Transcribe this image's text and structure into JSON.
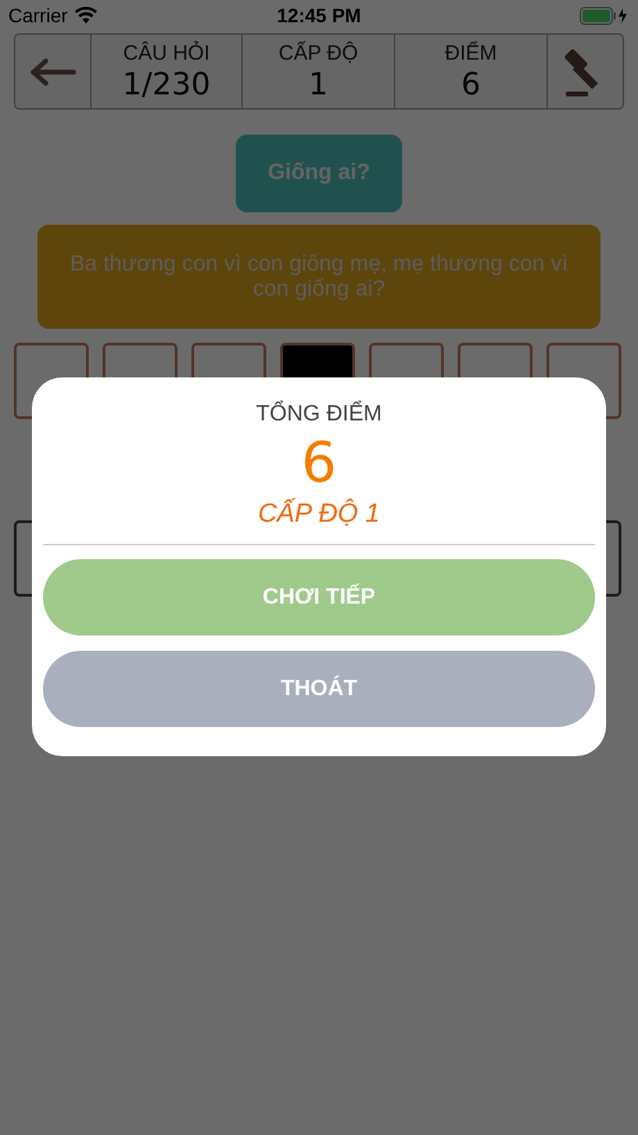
{
  "status_bar": {
    "carrier": "Carrier",
    "time": "12:45 PM"
  },
  "header": {
    "stats": [
      {
        "label": "CÂU HỎI",
        "value": "1/230"
      },
      {
        "label": "CẤP ĐỘ",
        "value": "1"
      },
      {
        "label": "ĐIỂM",
        "value": "6"
      }
    ]
  },
  "hint_button": "Giống ai?",
  "question": "Ba thương con vì con giống mẹ, mẹ thương con vì con giống ai?",
  "answer_slots": [
    {
      "selected": false
    },
    {
      "selected": false
    },
    {
      "selected": false
    },
    {
      "selected": true
    },
    {
      "selected": false
    },
    {
      "selected": false
    },
    {
      "selected": false
    }
  ],
  "dialog": {
    "title": "TỔNG ĐIỂM",
    "score": "6",
    "level": "CẤP ĐỘ 1",
    "buttons": [
      {
        "label": "CHƠI TIẾP",
        "kind": "primary"
      },
      {
        "label": "THOÁT",
        "kind": "secondary"
      }
    ]
  }
}
